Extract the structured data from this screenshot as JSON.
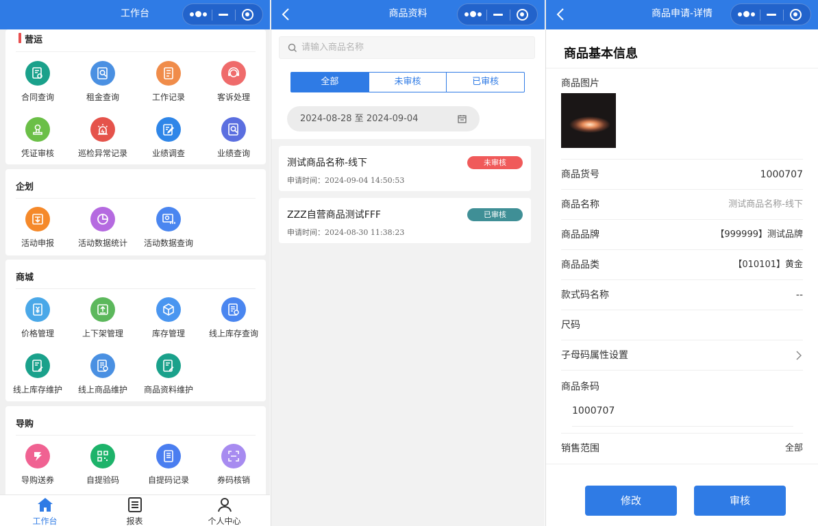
{
  "workbench": {
    "nav_title": "工作台",
    "sections": [
      {
        "title": "营运",
        "items": [
          {
            "label": "合同查询",
            "icon": "contract-search-icon",
            "color": "#1aa18b"
          },
          {
            "label": "租金查询",
            "icon": "rent-search-icon",
            "color": "#4a90e2"
          },
          {
            "label": "工作记录",
            "icon": "work-record-icon",
            "color": "#f08c4a"
          },
          {
            "label": "客诉处理",
            "icon": "customer-service-icon",
            "color": "#ef6b6b"
          },
          {
            "label": "凭证审核",
            "icon": "voucher-audit-icon",
            "color": "#6bbf47"
          },
          {
            "label": "巡检异常记录",
            "icon": "patrol-alarm-icon",
            "color": "#e5534b"
          },
          {
            "label": "业绩调查",
            "icon": "performance-survey-icon",
            "color": "#2f86e8"
          },
          {
            "label": "业绩查询",
            "icon": "performance-search-icon",
            "color": "#5b6fe0"
          }
        ]
      },
      {
        "title": "企划",
        "items": [
          {
            "label": "活动申报",
            "icon": "activity-report-icon",
            "color": "#f5892a"
          },
          {
            "label": "活动数据统计",
            "icon": "pie-chart-icon",
            "color": "#b56ae0"
          },
          {
            "label": "活动数据查询",
            "icon": "data-query-icon",
            "color": "#4a86f0"
          }
        ]
      },
      {
        "title": "商城",
        "items": [
          {
            "label": "价格管理",
            "icon": "price-management-icon",
            "color": "#4aa8e8"
          },
          {
            "label": "上下架管理",
            "icon": "shelf-management-icon",
            "color": "#5cb85c"
          },
          {
            "label": "库存管理",
            "icon": "inventory-box-icon",
            "color": "#4a96f0"
          },
          {
            "label": "线上库存查询",
            "icon": "online-inventory-search-icon",
            "color": "#4a86f0"
          },
          {
            "label": "线上库存维护",
            "icon": "online-inventory-maintain-icon",
            "color": "#1aa18b"
          },
          {
            "label": "线上商品维护",
            "icon": "online-product-maintain-icon",
            "color": "#4a90e2"
          },
          {
            "label": "商品资料维护",
            "icon": "product-info-maintain-icon",
            "color": "#1aa18b"
          }
        ]
      },
      {
        "title": "导购",
        "items": [
          {
            "label": "导购送券",
            "icon": "coupon-gift-icon",
            "color": "#f06292"
          },
          {
            "label": "自提验码",
            "icon": "qr-code-icon",
            "color": "#1db36a"
          },
          {
            "label": "自提码记录",
            "icon": "code-record-icon",
            "color": "#4a7ef0"
          },
          {
            "label": "券码核销",
            "icon": "scan-icon",
            "color": "#a78bf0"
          }
        ]
      }
    ],
    "tabs": [
      {
        "label": "工作台",
        "icon": "home-icon"
      },
      {
        "label": "报表",
        "icon": "report-icon"
      },
      {
        "label": "个人中心",
        "icon": "user-icon"
      }
    ]
  },
  "product_list": {
    "nav_title": "商品资料",
    "search_placeholder": "请输入商品名称",
    "filters": [
      "全部",
      "未审核",
      "已审核"
    ],
    "date_range": "2024-08-28 至 2024-09-04",
    "items": [
      {
        "name": "测试商品名称-线下",
        "time_label": "申请时间：",
        "time": "2024-09-04 14:50:53",
        "status": "未审核",
        "status_color": "#f05a5a"
      },
      {
        "name": "ZZZ自营商品测试FFF",
        "time_label": "申请时间：",
        "time": "2024-08-30 11:38:23",
        "status": "已审核",
        "status_color": "#3f8f96"
      }
    ]
  },
  "detail": {
    "nav_title": "商品申请-详情",
    "section_title": "商品基本信息",
    "image_label": "商品图片",
    "fields": [
      {
        "label": "商品货号",
        "value": "1000707"
      },
      {
        "label": "商品名称",
        "value": "测试商品名称-线下"
      },
      {
        "label": "商品品牌",
        "value": "【999999】测试品牌"
      },
      {
        "label": "商品品类",
        "value": "【010101】黄金"
      },
      {
        "label": "款式码名称",
        "value": "--"
      },
      {
        "label": "尺码",
        "value": ""
      },
      {
        "label": "子母码属性设置",
        "value": ""
      }
    ],
    "barcode_label": "商品条码",
    "barcode_value": "1000707",
    "sales_scope_label": "销售范围",
    "sales_scope_value": "全部",
    "edit_button": "修改",
    "audit_button": "审核"
  },
  "colors": {
    "primary": "#2f7be5",
    "accent_bar": "#e85050"
  }
}
